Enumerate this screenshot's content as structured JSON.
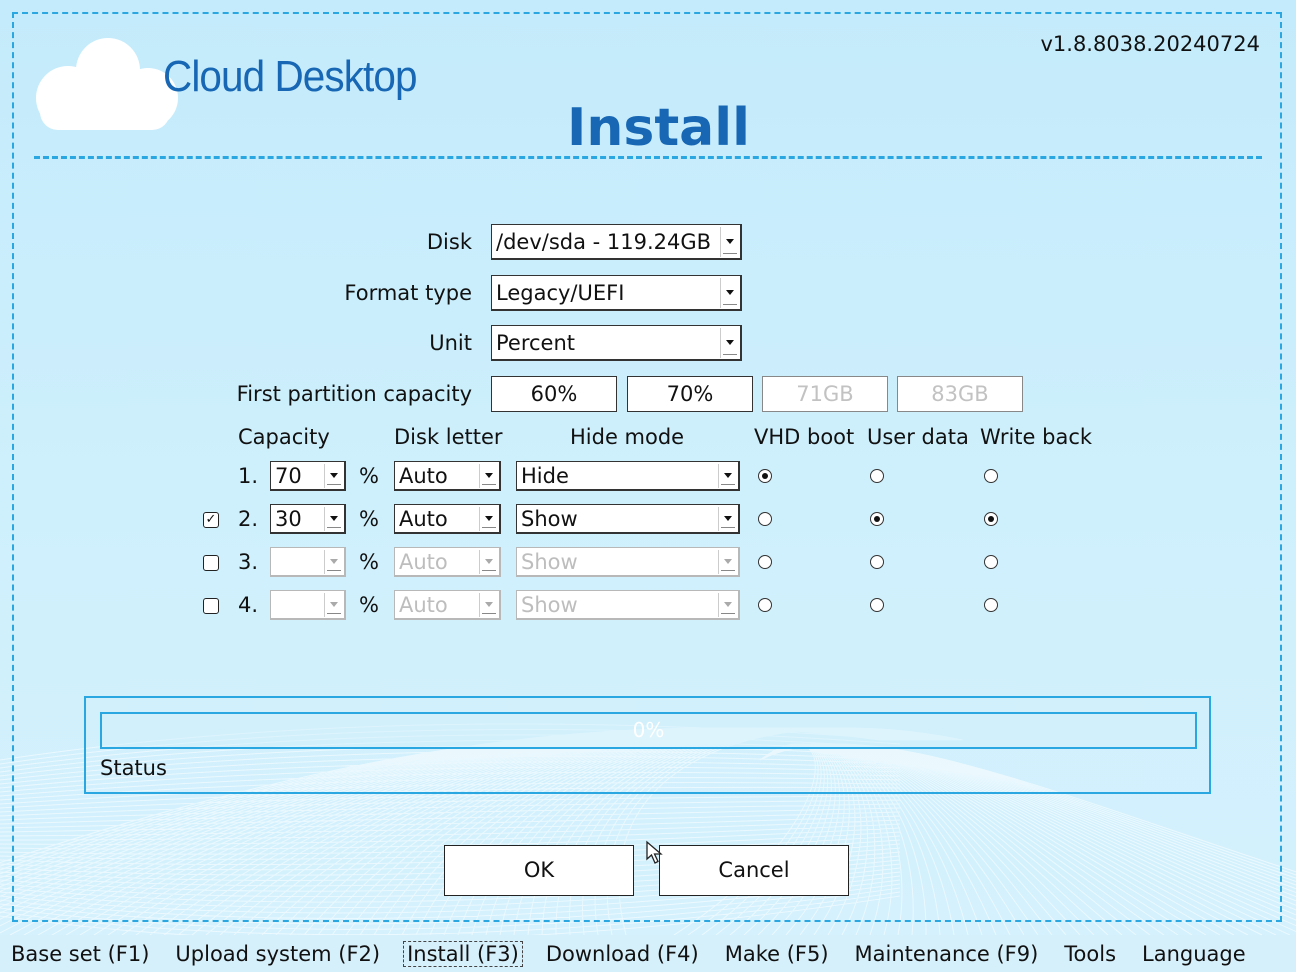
{
  "app": {
    "logo_text": "Cloud Desktop",
    "version": "v1.8.8038.20240724",
    "title": "Install"
  },
  "form": {
    "disk": {
      "label": "Disk",
      "value": "/dev/sda - 119.24GB"
    },
    "format_type": {
      "label": "Format type",
      "value": "Legacy/UEFI"
    },
    "unit": {
      "label": "Unit",
      "value": "Percent"
    },
    "first_partition": {
      "label": "First partition capacity",
      "options": [
        "60%",
        "70%",
        "71GB",
        "83GB"
      ]
    }
  },
  "partition_table": {
    "headers": {
      "capacity": "Capacity",
      "disk_letter": "Disk letter",
      "hide_mode": "Hide mode",
      "vhd_boot": "VHD boot",
      "user_data": "User data",
      "write_back": "Write back"
    },
    "percent_sign": "%",
    "rows": [
      {
        "index": "1.",
        "enabled": true,
        "has_checkbox": false,
        "checked": false,
        "capacity": "70",
        "disk_letter": "Auto",
        "hide_mode": "Hide",
        "vhd_boot": true,
        "user_data": false,
        "write_back": false
      },
      {
        "index": "2.",
        "enabled": true,
        "has_checkbox": true,
        "checked": true,
        "capacity": "30",
        "disk_letter": "Auto",
        "hide_mode": "Show",
        "vhd_boot": false,
        "user_data": true,
        "write_back": true
      },
      {
        "index": "3.",
        "enabled": false,
        "has_checkbox": true,
        "checked": false,
        "capacity": "",
        "disk_letter": "Auto",
        "hide_mode": "Show",
        "vhd_boot": false,
        "user_data": false,
        "write_back": false
      },
      {
        "index": "4.",
        "enabled": false,
        "has_checkbox": true,
        "checked": false,
        "capacity": "",
        "disk_letter": "Auto",
        "hide_mode": "Show",
        "vhd_boot": false,
        "user_data": false,
        "write_back": false
      }
    ]
  },
  "progress": {
    "value": 0,
    "text": "0%",
    "status_label": "Status"
  },
  "buttons": {
    "ok": "OK",
    "cancel": "Cancel"
  },
  "menu": {
    "items": [
      {
        "label": "Base set (F1)",
        "active": false
      },
      {
        "label": "Upload system (F2)",
        "active": false
      },
      {
        "label": "Install (F3)",
        "active": true
      },
      {
        "label": "Download (F4)",
        "active": false
      },
      {
        "label": "Make (F5)",
        "active": false
      },
      {
        "label": "Maintenance (F9)",
        "active": false
      },
      {
        "label": "Tools",
        "active": false
      },
      {
        "label": "Language",
        "active": false
      }
    ]
  },
  "colors": {
    "accent": "#2aa6e0",
    "title": "#1767b5",
    "background": "#cfeefb"
  }
}
